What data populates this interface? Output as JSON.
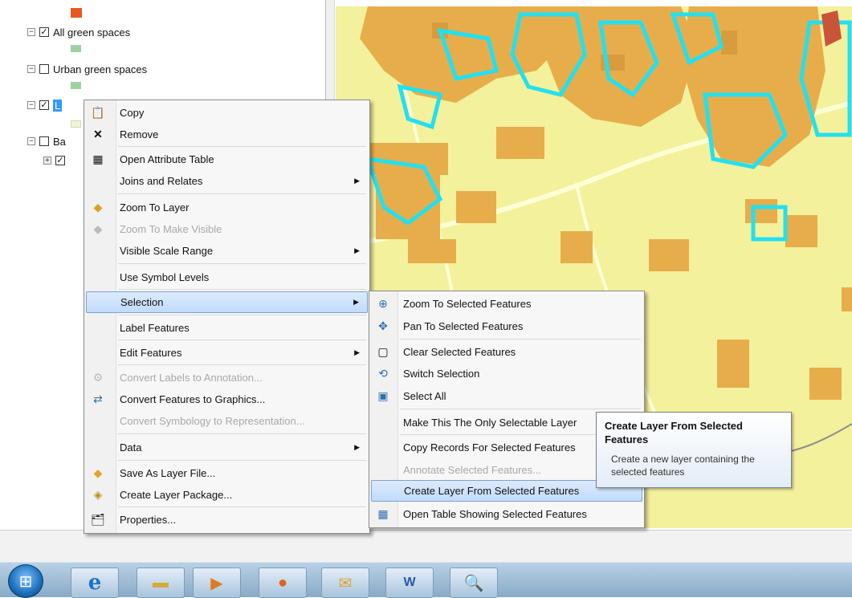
{
  "toc": {
    "layers": [
      {
        "label": "All green spaces",
        "checked": true,
        "swatch_color": "#9bd3a0"
      },
      {
        "label": "Urban green spaces",
        "checked": false,
        "swatch_color": "#9bd3a0"
      },
      {
        "label": "L",
        "checked": true,
        "swatch_color": "#eef6d8"
      },
      {
        "label": "Ba",
        "checked": false,
        "sublayer_checked": true
      }
    ],
    "top_swatch_color": "#e8571f"
  },
  "context_menu": {
    "items": [
      {
        "label": "Copy",
        "icon": "copy-icon"
      },
      {
        "label": "Remove",
        "icon": "remove-icon"
      },
      {
        "label": "Open Attribute Table",
        "icon": "table-icon"
      },
      {
        "label": "Joins and Relates",
        "submenu": true
      },
      {
        "label": "Zoom To Layer",
        "icon": "zoom-to-layer-icon"
      },
      {
        "label": "Zoom To Make Visible",
        "icon": "zoom-visible-icon",
        "disabled": true
      },
      {
        "label": "Visible Scale Range",
        "submenu": true
      },
      {
        "label": "Use Symbol Levels"
      },
      {
        "label": "Selection",
        "submenu": true,
        "highlighted": true
      },
      {
        "label": "Label Features"
      },
      {
        "label": "Edit Features",
        "submenu": true
      },
      {
        "label": "Convert Labels to Annotation...",
        "icon": "convert-labels-icon",
        "disabled": true
      },
      {
        "label": "Convert Features to Graphics...",
        "icon": "convert-graphics-icon"
      },
      {
        "label": "Convert Symbology to Representation...",
        "disabled": true
      },
      {
        "label": "Data",
        "submenu": true
      },
      {
        "label": "Save As Layer File...",
        "icon": "layer-file-icon"
      },
      {
        "label": "Create Layer Package...",
        "icon": "layer-package-icon"
      },
      {
        "label": "Properties...",
        "icon": "properties-icon"
      }
    ]
  },
  "selection_submenu": {
    "items": [
      {
        "label": "Zoom To Selected Features",
        "icon": "zoom-selected-icon"
      },
      {
        "label": "Pan To Selected Features",
        "icon": "pan-selected-icon"
      },
      {
        "label": "Clear Selected Features",
        "icon": "clear-selection-icon"
      },
      {
        "label": "Switch Selection",
        "icon": "switch-selection-icon"
      },
      {
        "label": "Select All",
        "icon": "select-all-icon"
      },
      {
        "label": "Make This The Only Selectable Layer"
      },
      {
        "label": "Copy Records For Selected Features"
      },
      {
        "label": "Annotate Selected Features...",
        "disabled": true
      },
      {
        "label": "Create Layer From Selected Features",
        "highlighted": true
      },
      {
        "label": "Open Table Showing Selected Features",
        "icon": "open-table-icon"
      }
    ]
  },
  "tooltip": {
    "title": "Create Layer From Selected Features",
    "body": "Create a new layer containing the selected features"
  },
  "taskbar": {
    "apps": [
      "start-button",
      "internet-explorer-icon",
      "file-explorer-icon",
      "media-player-icon",
      "firefox-icon",
      "outlook-icon",
      "word-icon",
      "search-app-icon"
    ]
  },
  "colors": {
    "map_background": "#f3f19c",
    "urban_patch": "#e7ad4b",
    "selection_outline": "#23e0f0",
    "menu_highlight": "#c1dbfc"
  }
}
